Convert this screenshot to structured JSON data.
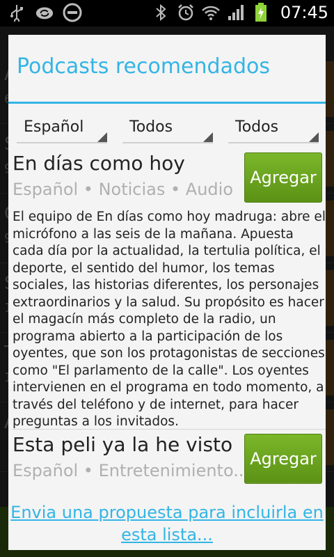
{
  "status_bar": {
    "time": "07:45",
    "icons_left": [
      "usb-icon",
      "sync-icon",
      "do-not-disturb-icon"
    ],
    "icons_right": [
      "bluetooth-icon",
      "alarm-icon",
      "wifi-icon",
      "signal-icon",
      "battery-charging-icon"
    ]
  },
  "background": {
    "letters": [
      "A",
      "6",
      "S",
      "9",
      "C",
      "9",
      "S",
      "1",
      "T",
      "1",
      "A"
    ]
  },
  "dialog": {
    "title": "Podcasts recomendados",
    "filters": {
      "language": "Español",
      "category": "Todos",
      "type": "Todos"
    },
    "items": [
      {
        "title": "En días como hoy",
        "meta": "Español • Noticias • Audio",
        "button": "Agregar",
        "description": "El equipo de En días como hoy madruga: abre el micrófono a las seis de la mañana. Apuesta cada día por la actualidad, la tertulia política, el deporte, el sentido del humor, los temas sociales, las historias diferentes, los personajes extraordinarios y la salud. Su propósito es hacer el magacín más completo de la radio, un programa abierto a la participación de los oyentes, que son los protagonistas de secciones como \"El parlamento de la calle\". Los oyentes intervienen en el programa en todo momento, a través del teléfono y de internet, para hacer preguntas a los invitados."
      },
      {
        "title": "Esta peli ya la he visto",
        "meta": "Español • Entretenimiento...",
        "button": "Agregar"
      }
    ],
    "propose_link": "Envia una propuesta para incluirla en esta lista..."
  }
}
